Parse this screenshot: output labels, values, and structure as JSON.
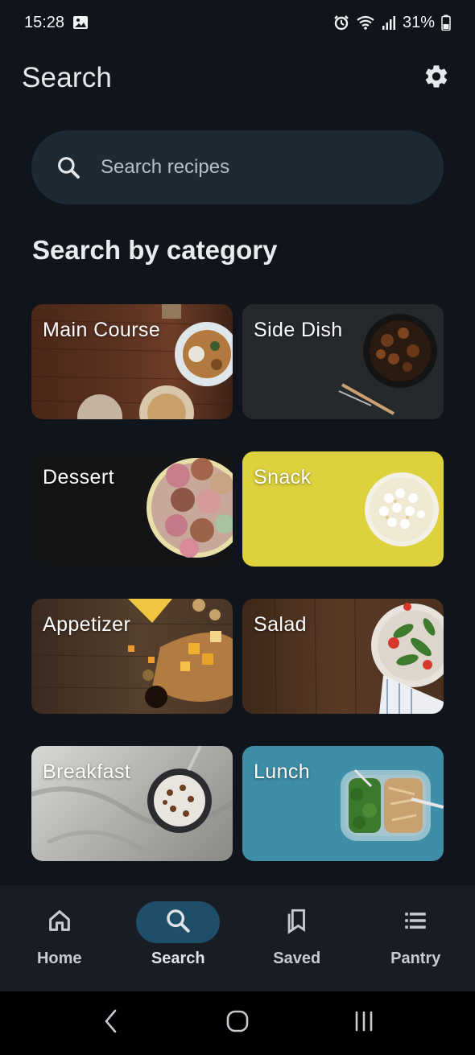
{
  "status_bar": {
    "time": "15:28",
    "battery": "31%",
    "icons": [
      "image-icon",
      "alarm-icon",
      "wifi-icon",
      "signal-icon",
      "battery-icon"
    ]
  },
  "app_bar": {
    "title": "Search",
    "settings_icon": "gear-icon"
  },
  "search": {
    "placeholder": "Search recipes",
    "icon": "search-icon"
  },
  "section": {
    "heading": "Search by category"
  },
  "categories": [
    {
      "label": "Main Course"
    },
    {
      "label": "Side Dish"
    },
    {
      "label": "Dessert"
    },
    {
      "label": "Snack"
    },
    {
      "label": "Appetizer"
    },
    {
      "label": "Salad"
    },
    {
      "label": "Breakfast"
    },
    {
      "label": "Lunch"
    }
  ],
  "bottom_nav": {
    "items": [
      {
        "label": "Home",
        "icon": "home-icon",
        "active": false
      },
      {
        "label": "Search",
        "icon": "search-icon",
        "active": true
      },
      {
        "label": "Saved",
        "icon": "bookmarks-icon",
        "active": false
      },
      {
        "label": "Pantry",
        "icon": "list-icon",
        "active": false
      }
    ]
  },
  "colors": {
    "background": "#10151b",
    "search_bg": "#1d2a34",
    "nav_active_pill": "#1f4e6b",
    "nav_bg": "#171d23"
  }
}
